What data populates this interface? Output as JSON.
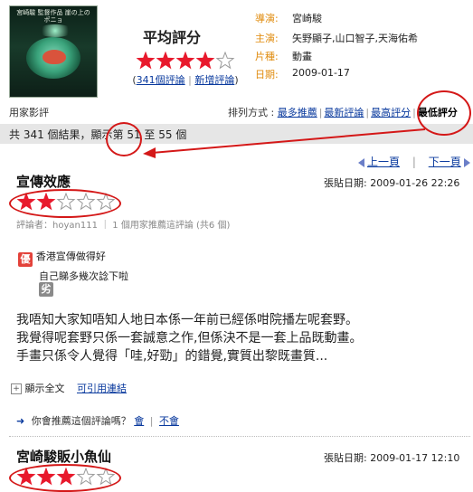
{
  "poster": {
    "title_text": "宮崎駿 監督作品 崖の上のポニョ"
  },
  "average": {
    "title": "平均評分",
    "stars_filled": 4,
    "stars_total": 5,
    "review_count_link": "341個評論",
    "add_review_link": "新增評論",
    "open_paren": "(",
    "close_paren": ")",
    "divider": "|"
  },
  "info": [
    {
      "label": "導演:",
      "value": "宮崎駿"
    },
    {
      "label": "主演:",
      "value": "矢野顯子,山口智子,天海佑希"
    },
    {
      "label": "片種:",
      "value": "動畫"
    },
    {
      "label": "日期:",
      "value": "2009-01-17"
    }
  ],
  "section_title": "用家影評",
  "sort": {
    "label": "排列方式 :",
    "options": [
      "最多推薦",
      "最新評論",
      "最高評分",
      "最低評分"
    ],
    "active": "最低評分"
  },
  "results_text": "共 341 個結果，顯示第 51 至 55 個",
  "pager": {
    "prev": "上一頁",
    "next": "下一頁",
    "divider": "|"
  },
  "reviews": [
    {
      "title": "宣傳效應",
      "date": "張貼日期: 2009-01-26 22:26",
      "stars_filled": 2,
      "stars_total": 5,
      "meta": "評論者：hoyan111 ｜ 1 個用家推薦這評論 (共6 個)",
      "pro_badge": "優",
      "pro_text": "香港宣傳做得好",
      "con_text": "自己睇多幾次諗下啦",
      "con_badge": "劣",
      "body": [
        "我唔知大家知唔知人地日本係一年前已經係咁院播左呢套野。",
        "我覺得呢套野只係一套誠意之作,但係決不是一套上品既動畫。",
        "手畫只係令人覺得「哇,好勁」的錯覺,實質出黎既畫質..."
      ],
      "show_full": "顯示全文",
      "permalink": "可引用連結",
      "recommend_q": "你會推薦這個評論嗎？",
      "yes": "會",
      "no": "不會",
      "divider": "|"
    },
    {
      "title": "宮崎駿販小魚仙",
      "date": "張貼日期: 2009-01-17 12:10",
      "stars_filled": 3,
      "stars_total": 5
    }
  ],
  "colors": {
    "star": "#e8192c",
    "annotation": "#d41818",
    "info_label": "#e08b0d",
    "link": "#0a3a9e",
    "pro_badge": "#e3423a",
    "con_badge": "#8a8a8a",
    "result_bar": "#e6e6e6"
  }
}
